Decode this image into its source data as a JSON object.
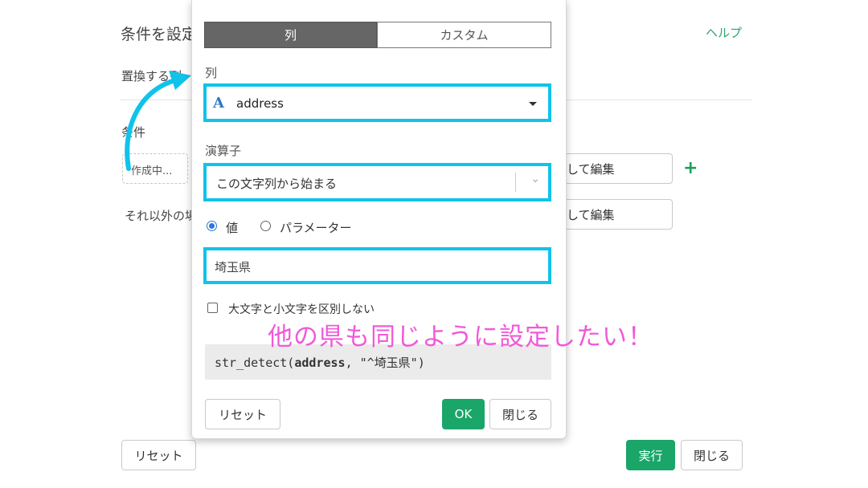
{
  "background": {
    "title": "条件を設定",
    "help_link": "ヘルプ",
    "replace_column_label": "置換する列",
    "conditions_label": "条件",
    "draft_placeholder": "作成中...",
    "edit_label_1": "して編集",
    "edit_label_2": "して編集",
    "otherwise_label": "それ以外の場",
    "reset_button": "リセット",
    "run_button": "実行",
    "close_button": "閉じる"
  },
  "popup": {
    "tabs": [
      "列",
      "カスタム"
    ],
    "active_tab": "列",
    "column_label": "列",
    "column_icon": "A",
    "column_value": "address",
    "operator_label": "演算子",
    "operator_value": "この文字列から始まる",
    "radio_value_label": "値",
    "radio_param_label": "パラメーター",
    "selected_radio": "値",
    "value_input": "埼玉県",
    "case_checkbox_label": "大文字と小文字を区別しない",
    "case_checkbox_checked": false,
    "code_prefix": "str_detect(",
    "code_arg": "address",
    "code_suffix": ", \"^埼玉県\")",
    "reset_button": "リセット",
    "ok_button": "OK",
    "close_button": "閉じる"
  },
  "annotation": {
    "text": "他の県も同じように設定したい！",
    "color": "#f05ad8",
    "highlight_color": "#10c3ea"
  }
}
